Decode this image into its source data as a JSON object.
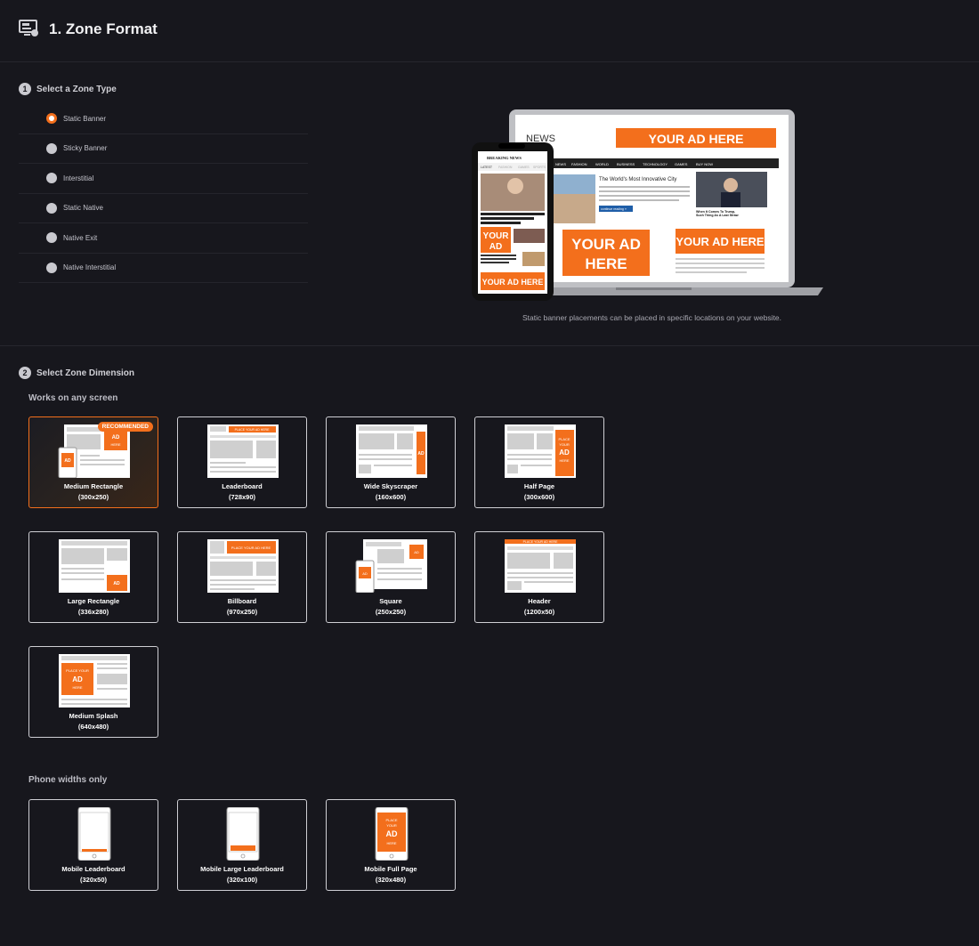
{
  "header": {
    "title": "1. Zone Format",
    "icon": "zone-monitor-icon"
  },
  "step1": {
    "number": "1",
    "title": "Select a Zone Type",
    "options": [
      {
        "label": "Static Banner",
        "selected": true
      },
      {
        "label": "Sticky Banner",
        "selected": false
      },
      {
        "label": "Interstitial",
        "selected": false
      },
      {
        "label": "Static Native",
        "selected": false
      },
      {
        "label": "Native Exit",
        "selected": false
      },
      {
        "label": "Native Interstitial",
        "selected": false
      }
    ]
  },
  "preview": {
    "laptop_brand": "NEWS",
    "laptop_nav": [
      "NEWS",
      "FASHION",
      "WORLD",
      "BUSINESS",
      "TECHNOLOGY",
      "GAMES",
      "BUY NOW"
    ],
    "laptop_headline": "The World's Most Innovative City",
    "laptop_side_headline": "When It Comes To Trump, \"There Is No Such Thing As A Last Straw\" For Republicans",
    "continue_label": "continue reading »",
    "phone_brand": "BREAKING NEWS",
    "phone_tabs": [
      "LATEST",
      "FASHION",
      "GAMES",
      "SPORTS"
    ],
    "phone_headline": "Dawood plotted attacks on churches, RSS leaders to ease religious",
    "ad_text": "YOUR AD HERE",
    "ad_line1": "YOUR AD",
    "ad_line2": "HERE",
    "ad_short1": "YOUR",
    "ad_short2": "AD",
    "caption": "Static banner placements can be placed in specific locations on your website."
  },
  "step2": {
    "number": "2",
    "title": "Select Zone Dimension",
    "any_screen_label": "Works on any screen",
    "phone_only_label": "Phone widths only",
    "recommended_label": "RECOMMENDED",
    "thumb_text": {
      "place": "PLACE",
      "your": "YOUR",
      "ad": "AD",
      "here": "HERE",
      "place_your_ad_here": "PLACE YOUR AD HERE",
      "place_your": "PLACE YOUR"
    },
    "any_screen": [
      {
        "name": "Medium Rectangle",
        "size": "(300x250)",
        "selected": true
      },
      {
        "name": "Leaderboard",
        "size": "(728x90)",
        "selected": false
      },
      {
        "name": "Wide Skyscraper",
        "size": "(160x600)",
        "selected": false
      },
      {
        "name": "Half Page",
        "size": "(300x600)",
        "selected": false
      },
      {
        "name": "Large Rectangle",
        "size": "(336x280)",
        "selected": false
      },
      {
        "name": "Billboard",
        "size": "(970x250)",
        "selected": false
      },
      {
        "name": "Square",
        "size": "(250x250)",
        "selected": false
      },
      {
        "name": "Header",
        "size": "(1200x50)",
        "selected": false
      },
      {
        "name": "Medium Splash",
        "size": "(640x480)",
        "selected": false
      }
    ],
    "phone_only": [
      {
        "name": "Mobile Leaderboard",
        "size": "(320x50)",
        "selected": false
      },
      {
        "name": "Mobile Large Leaderboard",
        "size": "(320x100)",
        "selected": false
      },
      {
        "name": "Mobile Full Page",
        "size": "(320x480)",
        "selected": false
      }
    ]
  },
  "colors": {
    "accent": "#f36f1c",
    "background": "#17171d",
    "card_border": "#cfcfd4"
  }
}
